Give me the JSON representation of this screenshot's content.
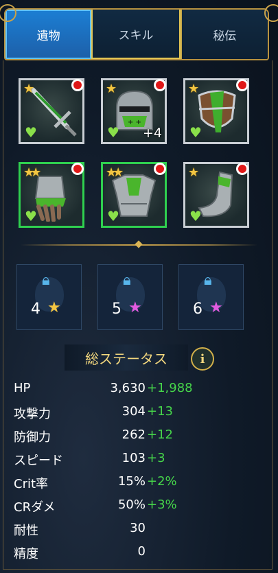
{
  "tabs": [
    {
      "label": "遺物",
      "active": true
    },
    {
      "label": "スキル",
      "active": false
    },
    {
      "label": "秘伝",
      "active": false
    }
  ],
  "artifacts": [
    {
      "name": "sword",
      "stars": 1,
      "level_badge": "",
      "selected": false
    },
    {
      "name": "helmet",
      "stars": 1,
      "level_badge": "+4",
      "selected": false
    },
    {
      "name": "shield",
      "stars": 1,
      "level_badge": "",
      "selected": false
    },
    {
      "name": "gauntlets",
      "stars": 2,
      "level_badge": "",
      "selected": true
    },
    {
      "name": "chestplate",
      "stars": 2,
      "level_badge": "",
      "selected": true
    },
    {
      "name": "boots",
      "stars": 1,
      "level_badge": "",
      "selected": false
    }
  ],
  "set_bonuses": [
    {
      "count": "4",
      "star_color": "#f2c542"
    },
    {
      "count": "5",
      "star_color": "#e25be0"
    },
    {
      "count": "6",
      "star_color": "#e25be0"
    }
  ],
  "status": {
    "title": "総ステータス",
    "info_icon": "i",
    "rows": [
      {
        "label": "HP",
        "value": "3,630",
        "bonus": "+1,988"
      },
      {
        "label": "攻撃力",
        "value": "304",
        "bonus": "+13"
      },
      {
        "label": "防御力",
        "value": "262",
        "bonus": "+12"
      },
      {
        "label": "スピード",
        "value": "103",
        "bonus": "+3"
      },
      {
        "label": "Crit率",
        "value": "15%",
        "bonus": "+2%"
      },
      {
        "label": "CRダメ",
        "value": "50%",
        "bonus": "+3%"
      },
      {
        "label": "耐性",
        "value": "30",
        "bonus": ""
      },
      {
        "label": "精度",
        "value": "0",
        "bonus": ""
      }
    ]
  },
  "colors": {
    "accent_blue": "#1d7fd4",
    "gold": "#c9a24a",
    "bonus_green": "#46d64a"
  },
  "icons": {
    "lock": "lock-icon",
    "heart": "heart-icon",
    "star": "star-icon",
    "alert": "alert-dot-icon"
  }
}
